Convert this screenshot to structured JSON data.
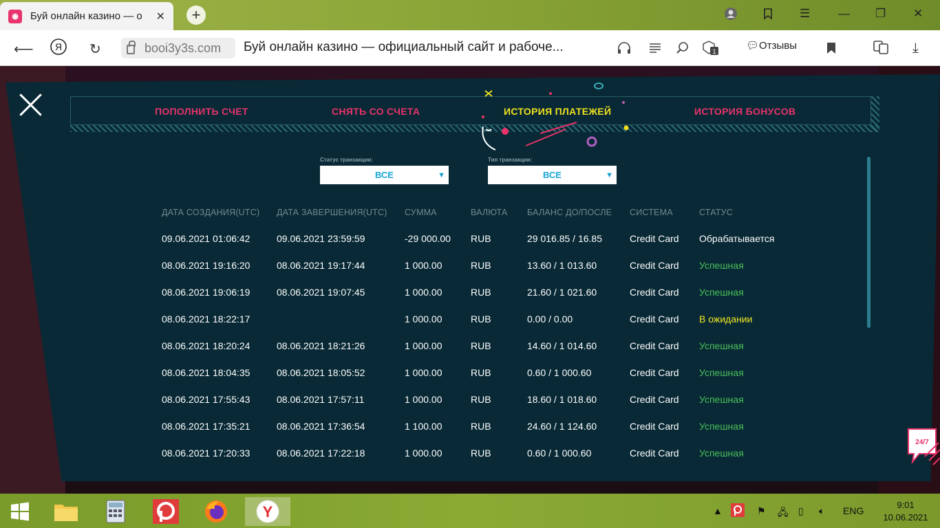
{
  "browser": {
    "tab_title": "Буй онлайн казино — о",
    "domain": "booi3y3s.com",
    "page_title": "Буй онлайн казино — официальный сайт и рабоче...",
    "reviews_label": "Отзывы"
  },
  "modal": {
    "tabs": [
      {
        "label": "ПОПОЛНИТЬ СЧЕТ",
        "active": false
      },
      {
        "label": "СНЯТЬ СО СЧЕТА",
        "active": false
      },
      {
        "label": "ИСТОРИЯ ПЛАТЕЖЕЙ",
        "active": true
      },
      {
        "label": "ИСТОРИЯ БОНУСОВ",
        "active": false
      }
    ],
    "filters": {
      "status_label": "Статус транзакции:",
      "status_value": "ВСЕ",
      "type_label": "Тип транзакции:",
      "type_value": "ВСЕ"
    },
    "table": {
      "headers": [
        "ДАТА СОЗДАНИЯ(UTC)",
        "ДАТА ЗАВЕРШЕНИЯ(UTC)",
        "СУММА",
        "ВАЛЮТА",
        "БАЛАНС ДО/ПОСЛЕ",
        "СИСТЕМА",
        "СТАТУС"
      ],
      "rows": [
        {
          "created": "09.06.2021 01:06:42",
          "completed": "09.06.2021 23:59:59",
          "amount": "-29 000.00",
          "currency": "RUB",
          "balance": "29 016.85 / 16.85",
          "system": "Credit Card",
          "status": "Обрабатывается",
          "status_kind": "process"
        },
        {
          "created": "08.06.2021 19:16:20",
          "completed": "08.06.2021 19:17:44",
          "amount": "1 000.00",
          "currency": "RUB",
          "balance": "13.60 / 1 013.60",
          "system": "Credit Card",
          "status": "Успешная",
          "status_kind": "success"
        },
        {
          "created": "08.06.2021 19:06:19",
          "completed": "08.06.2021 19:07:45",
          "amount": "1 000.00",
          "currency": "RUB",
          "balance": "21.60 / 1 021.60",
          "system": "Credit Card",
          "status": "Успешная",
          "status_kind": "success"
        },
        {
          "created": "08.06.2021 18:22:17",
          "completed": "",
          "amount": "1 000.00",
          "currency": "RUB",
          "balance": "0.00 / 0.00",
          "system": "Credit Card",
          "status": "В ожидании",
          "status_kind": "pending"
        },
        {
          "created": "08.06.2021 18:20:24",
          "completed": "08.06.2021 18:21:26",
          "amount": "1 000.00",
          "currency": "RUB",
          "balance": "14.60 / 1 014.60",
          "system": "Credit Card",
          "status": "Успешная",
          "status_kind": "success"
        },
        {
          "created": "08.06.2021 18:04:35",
          "completed": "08.06.2021 18:05:52",
          "amount": "1 000.00",
          "currency": "RUB",
          "balance": "0.60 / 1 000.60",
          "system": "Credit Card",
          "status": "Успешная",
          "status_kind": "success"
        },
        {
          "created": "08.06.2021 17:55:43",
          "completed": "08.06.2021 17:57:11",
          "amount": "1 000.00",
          "currency": "RUB",
          "balance": "18.60 / 1 018.60",
          "system": "Credit Card",
          "status": "Успешная",
          "status_kind": "success"
        },
        {
          "created": "08.06.2021 17:35:21",
          "completed": "08.06.2021 17:36:54",
          "amount": "1 100.00",
          "currency": "RUB",
          "balance": "24.60 / 1 124.60",
          "system": "Credit Card",
          "status": "Успешная",
          "status_kind": "success"
        },
        {
          "created": "08.06.2021 17:20:33",
          "completed": "08.06.2021 17:22:18",
          "amount": "1 000.00",
          "currency": "RUB",
          "balance": "0.60 / 1 000.60",
          "system": "Credit Card",
          "status": "Успешная",
          "status_kind": "success"
        }
      ]
    },
    "support_badge": "24/7"
  },
  "taskbar": {
    "lang": "ENG",
    "time": "9:01",
    "date": "10.06.2021"
  },
  "colors": {
    "modal_bg": "#082935",
    "tab_pink": "#e8336b",
    "tab_active_yellow": "#f0e020",
    "status_success": "#4bc05c",
    "status_pending": "#f2e825",
    "select_text": "#1aa7d8"
  }
}
